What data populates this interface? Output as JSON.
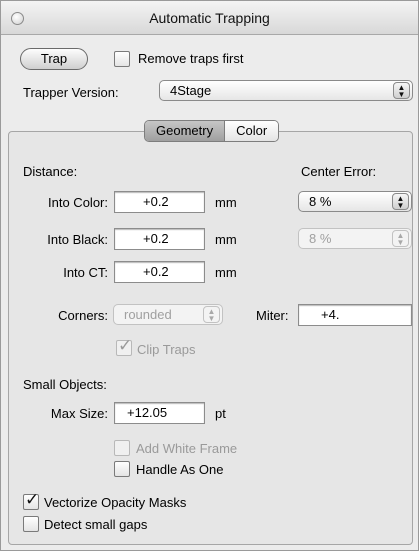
{
  "window": {
    "title": "Automatic Trapping"
  },
  "top": {
    "trap_button": "Trap",
    "remove_traps_label": "Remove traps first",
    "remove_traps_checked": false,
    "trapper_version_label": "Trapper Version:",
    "trapper_version_value": "4Stage"
  },
  "tabs": [
    {
      "label": "Geometry",
      "active": true
    },
    {
      "label": "Color",
      "active": false
    }
  ],
  "distance": {
    "heading": "Distance:",
    "into_color_label": "Into Color:",
    "into_color_value": "+0.2",
    "into_black_label": "Into Black:",
    "into_black_value": "+0.2",
    "into_ct_label": "Into CT:",
    "into_ct_value": "+0.2",
    "unit": "mm"
  },
  "center_error": {
    "label": "Center Error:",
    "value_1": "8 %",
    "value_2": "8 %"
  },
  "corners": {
    "label": "Corners:",
    "value": "rounded",
    "miter_label": "Miter:",
    "miter_value": "+4.",
    "clip_traps_label": "Clip Traps",
    "clip_traps_checked": true
  },
  "small_objects": {
    "heading": "Small Objects:",
    "max_size_label": "Max Size:",
    "max_size_value": "+12.05",
    "unit": "pt",
    "add_white_frame_label": "Add White Frame",
    "add_white_frame_checked": false,
    "handle_as_one_label": "Handle As One",
    "handle_as_one_checked": false
  },
  "bottom": {
    "vectorize_label": "Vectorize Opacity Masks",
    "vectorize_checked": true,
    "detect_gaps_label": "Detect small gaps",
    "detect_gaps_checked": false
  },
  "icons": {
    "checkmark": "✓",
    "select_arrows": "▲▼"
  }
}
